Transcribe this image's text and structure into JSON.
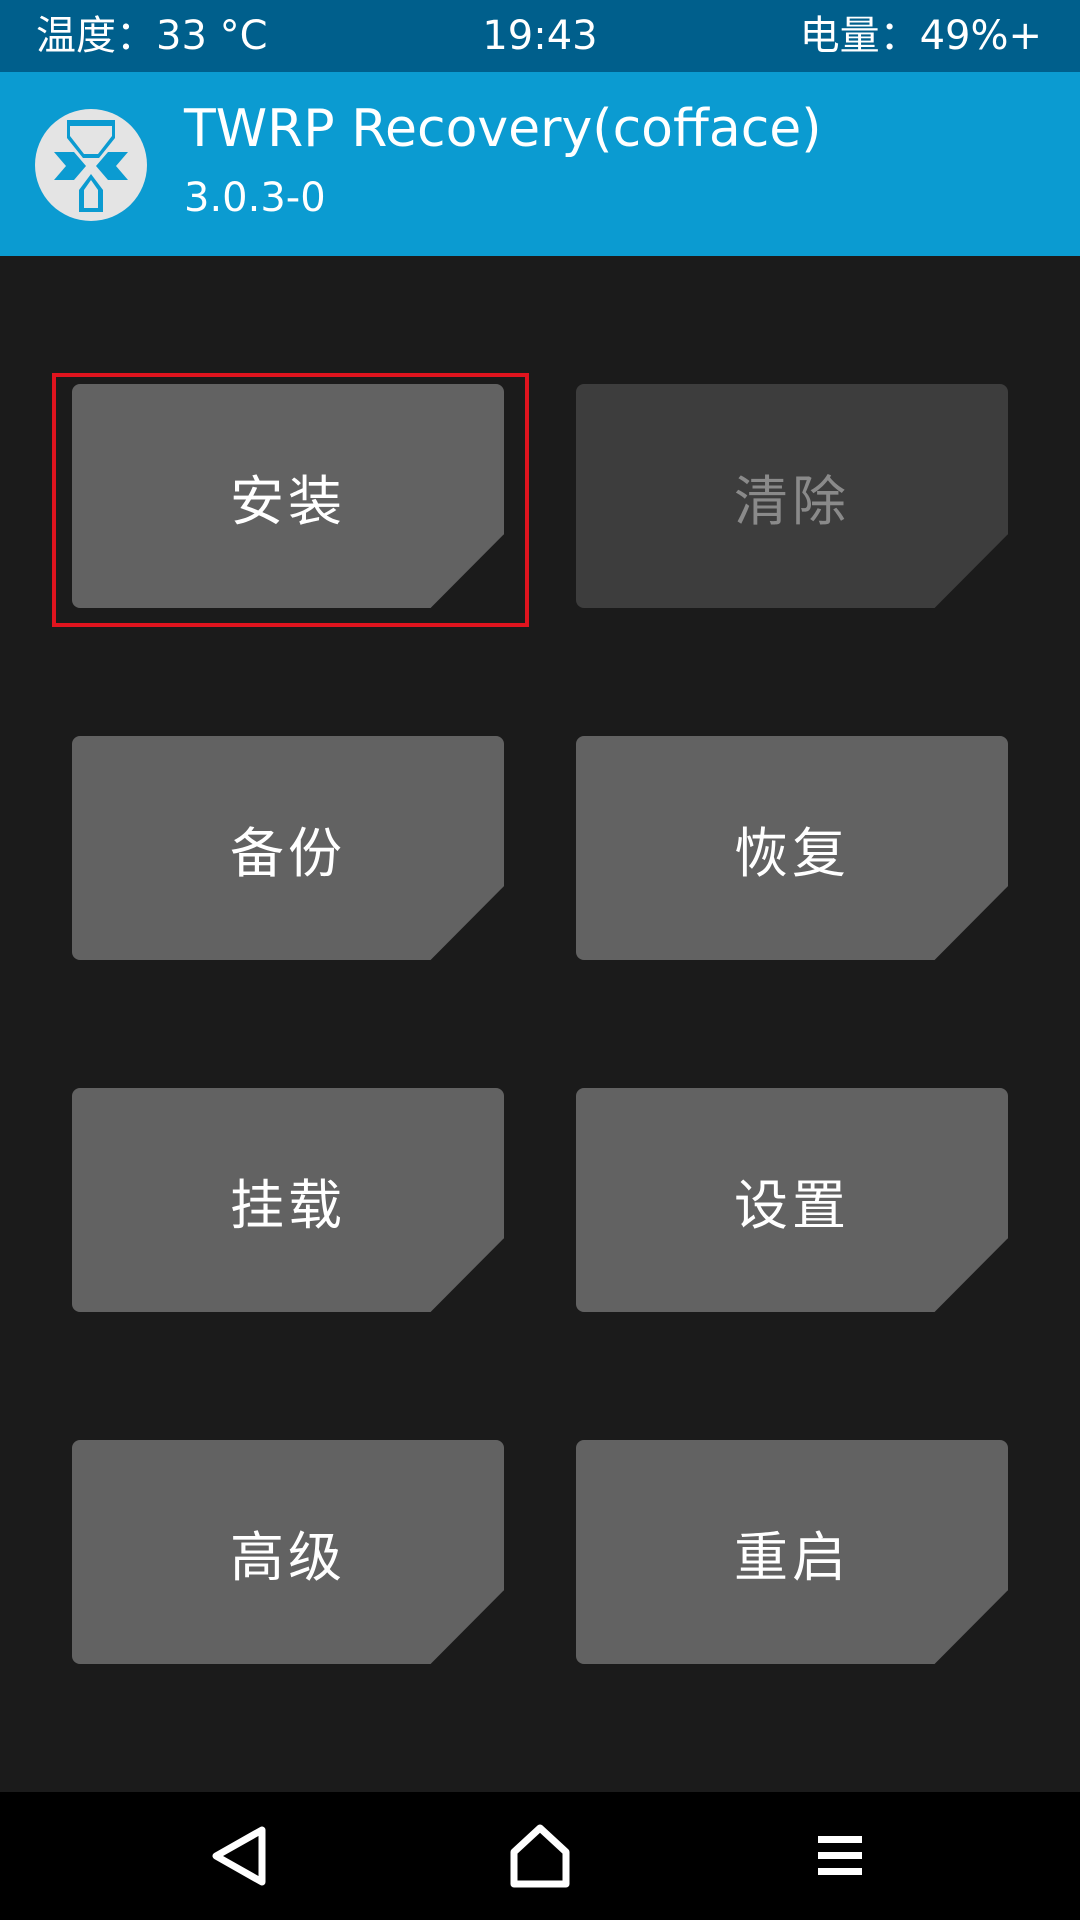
{
  "status_bar": {
    "temperature": "温度：33 °C",
    "time": "19:43",
    "battery": "电量：49%+"
  },
  "header": {
    "title": "TWRP Recovery(cofface)",
    "version": "3.0.3-0",
    "logo_icon": "twrp-logo-icon"
  },
  "buttons": {
    "install": "安装",
    "wipe": "清除",
    "backup": "备份",
    "restore": "恢复",
    "mount": "挂载",
    "settings": "设置",
    "advanced": "高级",
    "reboot": "重启"
  },
  "states": {
    "wipe_disabled": true,
    "highlighted": "install"
  },
  "navigation": {
    "back_icon": "back-triangle-icon",
    "home_icon": "home-icon",
    "menu_icon": "menu-lines-icon"
  },
  "colors": {
    "status_bar": "#005f8c",
    "header": "#0b9bd1",
    "background": "#1b1b1b",
    "tile": "#626262",
    "tile_disabled": "#3d3d3d",
    "highlight": "#e0141e"
  }
}
